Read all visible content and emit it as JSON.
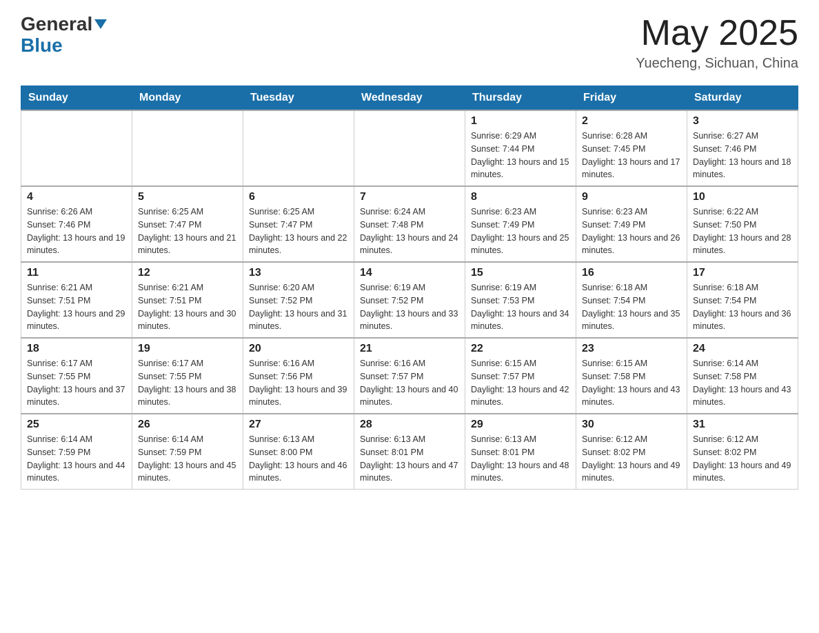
{
  "header": {
    "logo": {
      "general": "General",
      "blue": "Blue",
      "arrow": "▼"
    },
    "month_year": "May 2025",
    "location": "Yuecheng, Sichuan, China"
  },
  "weekdays": [
    "Sunday",
    "Monday",
    "Tuesday",
    "Wednesday",
    "Thursday",
    "Friday",
    "Saturday"
  ],
  "weeks": [
    {
      "days": [
        {
          "num": "",
          "info": ""
        },
        {
          "num": "",
          "info": ""
        },
        {
          "num": "",
          "info": ""
        },
        {
          "num": "",
          "info": ""
        },
        {
          "num": "1",
          "info": "Sunrise: 6:29 AM\nSunset: 7:44 PM\nDaylight: 13 hours and 15 minutes."
        },
        {
          "num": "2",
          "info": "Sunrise: 6:28 AM\nSunset: 7:45 PM\nDaylight: 13 hours and 17 minutes."
        },
        {
          "num": "3",
          "info": "Sunrise: 6:27 AM\nSunset: 7:46 PM\nDaylight: 13 hours and 18 minutes."
        }
      ]
    },
    {
      "days": [
        {
          "num": "4",
          "info": "Sunrise: 6:26 AM\nSunset: 7:46 PM\nDaylight: 13 hours and 19 minutes."
        },
        {
          "num": "5",
          "info": "Sunrise: 6:25 AM\nSunset: 7:47 PM\nDaylight: 13 hours and 21 minutes."
        },
        {
          "num": "6",
          "info": "Sunrise: 6:25 AM\nSunset: 7:47 PM\nDaylight: 13 hours and 22 minutes."
        },
        {
          "num": "7",
          "info": "Sunrise: 6:24 AM\nSunset: 7:48 PM\nDaylight: 13 hours and 24 minutes."
        },
        {
          "num": "8",
          "info": "Sunrise: 6:23 AM\nSunset: 7:49 PM\nDaylight: 13 hours and 25 minutes."
        },
        {
          "num": "9",
          "info": "Sunrise: 6:23 AM\nSunset: 7:49 PM\nDaylight: 13 hours and 26 minutes."
        },
        {
          "num": "10",
          "info": "Sunrise: 6:22 AM\nSunset: 7:50 PM\nDaylight: 13 hours and 28 minutes."
        }
      ]
    },
    {
      "days": [
        {
          "num": "11",
          "info": "Sunrise: 6:21 AM\nSunset: 7:51 PM\nDaylight: 13 hours and 29 minutes."
        },
        {
          "num": "12",
          "info": "Sunrise: 6:21 AM\nSunset: 7:51 PM\nDaylight: 13 hours and 30 minutes."
        },
        {
          "num": "13",
          "info": "Sunrise: 6:20 AM\nSunset: 7:52 PM\nDaylight: 13 hours and 31 minutes."
        },
        {
          "num": "14",
          "info": "Sunrise: 6:19 AM\nSunset: 7:52 PM\nDaylight: 13 hours and 33 minutes."
        },
        {
          "num": "15",
          "info": "Sunrise: 6:19 AM\nSunset: 7:53 PM\nDaylight: 13 hours and 34 minutes."
        },
        {
          "num": "16",
          "info": "Sunrise: 6:18 AM\nSunset: 7:54 PM\nDaylight: 13 hours and 35 minutes."
        },
        {
          "num": "17",
          "info": "Sunrise: 6:18 AM\nSunset: 7:54 PM\nDaylight: 13 hours and 36 minutes."
        }
      ]
    },
    {
      "days": [
        {
          "num": "18",
          "info": "Sunrise: 6:17 AM\nSunset: 7:55 PM\nDaylight: 13 hours and 37 minutes."
        },
        {
          "num": "19",
          "info": "Sunrise: 6:17 AM\nSunset: 7:55 PM\nDaylight: 13 hours and 38 minutes."
        },
        {
          "num": "20",
          "info": "Sunrise: 6:16 AM\nSunset: 7:56 PM\nDaylight: 13 hours and 39 minutes."
        },
        {
          "num": "21",
          "info": "Sunrise: 6:16 AM\nSunset: 7:57 PM\nDaylight: 13 hours and 40 minutes."
        },
        {
          "num": "22",
          "info": "Sunrise: 6:15 AM\nSunset: 7:57 PM\nDaylight: 13 hours and 42 minutes."
        },
        {
          "num": "23",
          "info": "Sunrise: 6:15 AM\nSunset: 7:58 PM\nDaylight: 13 hours and 43 minutes."
        },
        {
          "num": "24",
          "info": "Sunrise: 6:14 AM\nSunset: 7:58 PM\nDaylight: 13 hours and 43 minutes."
        }
      ]
    },
    {
      "days": [
        {
          "num": "25",
          "info": "Sunrise: 6:14 AM\nSunset: 7:59 PM\nDaylight: 13 hours and 44 minutes."
        },
        {
          "num": "26",
          "info": "Sunrise: 6:14 AM\nSunset: 7:59 PM\nDaylight: 13 hours and 45 minutes."
        },
        {
          "num": "27",
          "info": "Sunrise: 6:13 AM\nSunset: 8:00 PM\nDaylight: 13 hours and 46 minutes."
        },
        {
          "num": "28",
          "info": "Sunrise: 6:13 AM\nSunset: 8:01 PM\nDaylight: 13 hours and 47 minutes."
        },
        {
          "num": "29",
          "info": "Sunrise: 6:13 AM\nSunset: 8:01 PM\nDaylight: 13 hours and 48 minutes."
        },
        {
          "num": "30",
          "info": "Sunrise: 6:12 AM\nSunset: 8:02 PM\nDaylight: 13 hours and 49 minutes."
        },
        {
          "num": "31",
          "info": "Sunrise: 6:12 AM\nSunset: 8:02 PM\nDaylight: 13 hours and 49 minutes."
        }
      ]
    }
  ]
}
